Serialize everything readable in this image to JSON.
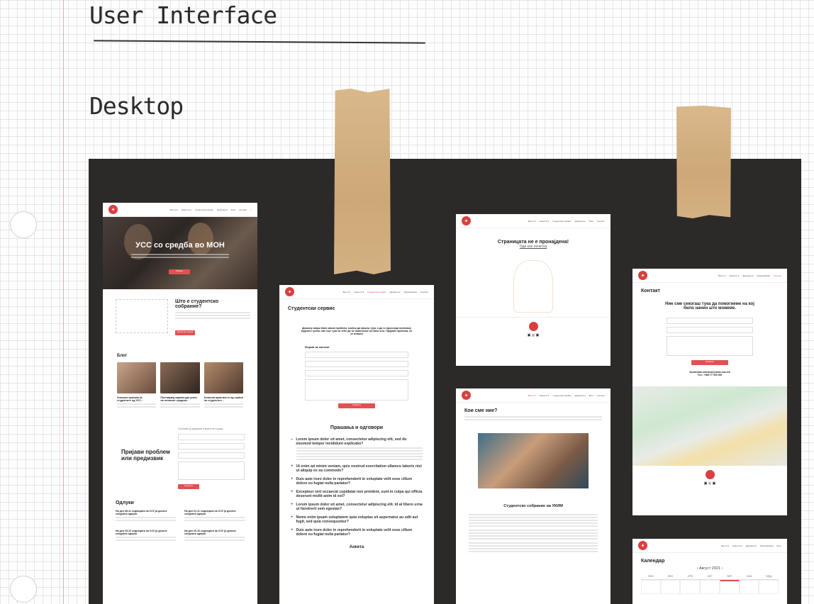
{
  "heading": {
    "title": "User Interface",
    "subtitle": "Desktop"
  },
  "nav": {
    "links": [
      "Вести ▾",
      "Новости ▾",
      "Студентски сервис",
      "Документи",
      "Прашофобия",
      "Блог",
      "Студентски организации",
      "Контакт"
    ]
  },
  "home": {
    "hero_title": "УСС со средба во МОН",
    "hero_button": "Повеќе",
    "about_title": "Што е студентско собрание?",
    "about_button": "Прочитај повеќе",
    "blog_title": "Блог",
    "blog_posts": [
      "Успешна прихаќа за студентите од УСС...",
      "Поставувај карикатура успех на неговиот сродник...",
      "Освоена прва место од страна на студентите..."
    ],
    "apply_title": "Пријави проблем или предизвик",
    "apply_intro": "Потполни ја формата и прати ни порака.",
    "apply_button": "Испрати",
    "decisions_title": "Одлуки",
    "decisions": [
      "На ден 08.11 седницата на ССУ ја донесе следната одлука",
      "На ден 01.11 седницата на ССУ ја донесе следната одлука",
      "На ден 25.10 седницата на ССУ ја донесе следната одлука",
      "На ден 20.10 седницата на ССУ ја донесе следната одлука"
    ]
  },
  "service": {
    "title": "Студентски сервис",
    "intro": "Доколку имаш било каков проблем, моќеш да пишеш тука, а да го проследи понатаму кадешто треба, ние сме тука за тебе да ти помогнеме за било што. Пријави проблем, не се плаши!",
    "form_title": "Форма за контакт",
    "button": "Испрати",
    "faq_title": "Прашања и одговори",
    "faq": [
      "Lorem ipsum dolor sit amet, consectetur adipiscing elit, sed do eiusmod tempor incididunt explicabo?",
      "Ut enim ad minim veniam, quis nostrud exercitation ullamco laboris nisi ut aliquip ex ea commodo?",
      "Duis aute irure dolor in reprehenderit in voluptate velit esse cillum dolore eu fugiat nulla pariatur?",
      "Excepteur sint occaecat cupidatat non proident, sunt in culpa qui officia deserunt mollit anim id est?",
      "Lorem ipsum dolor sit amet, consectetur adipiscing elit. Id at libero urna ut hendrerit sem egestas?",
      "Nemo enim ipsam voluptatem quia voluptas sit aspernatur au odit aut fugit, sed quia consequuntur?",
      "Duis aute irure dolor in reprehenderit in voluptate velit esse cillum dolore eu fugiat nulla pariatur?"
    ],
    "poll_title": "Анкета"
  },
  "notfound": {
    "title": "Страницата не е пронајдена!",
    "link": "Оди кон почетна"
  },
  "about": {
    "title": "Кои сме ние?",
    "section_title": "Студентско собрание на УКИМ"
  },
  "contact": {
    "title": "Контакт",
    "tagline": "Ние сме секогаш тука да помогнеме на кој било начин што можеме.",
    "button": "Испрати",
    "email": "studentsko.sobranie@ukim.edu.mk",
    "phone": "Тел.: +389 77 000 000"
  },
  "calendar": {
    "title": "Календар",
    "month": "Август 2021",
    "days": [
      "ПОН",
      "ВТО",
      "СРЕ",
      "ЧЕТ",
      "ПЕТ",
      "САБ",
      "НЕД"
    ]
  },
  "colors": {
    "accent": "#e05252",
    "board": "#2c2929",
    "tape": "#cda877"
  }
}
